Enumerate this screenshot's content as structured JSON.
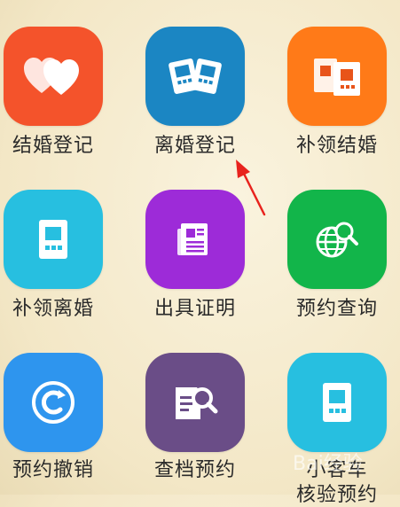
{
  "services": [
    {
      "label": "结婚登记",
      "icon": "hearts-icon",
      "color": "#f4532b"
    },
    {
      "label": "离婚登记",
      "icon": "split-certificates-icon",
      "color": "#1b86c3"
    },
    {
      "label": "补领结婚",
      "icon": "certificate-pair-icon",
      "color": "#ff7a18"
    },
    {
      "label": "补领离婚",
      "icon": "certificate-icon",
      "color": "#27bfe0"
    },
    {
      "label": "出具证明",
      "icon": "document-icon",
      "color": "#9d2bd8"
    },
    {
      "label": "预约查询",
      "icon": "globe-search-icon",
      "color": "#12b54a"
    },
    {
      "label": "预约撤销",
      "icon": "cancel-circle-icon",
      "color": "#2e95ee"
    },
    {
      "label": "查档预约",
      "icon": "file-search-icon",
      "color": "#6a4d87"
    },
    {
      "label": "小客车",
      "label2": "核验预约",
      "icon": "certificate-icon",
      "color": "#27bfe0"
    }
  ],
  "watermark": "Bai经验"
}
